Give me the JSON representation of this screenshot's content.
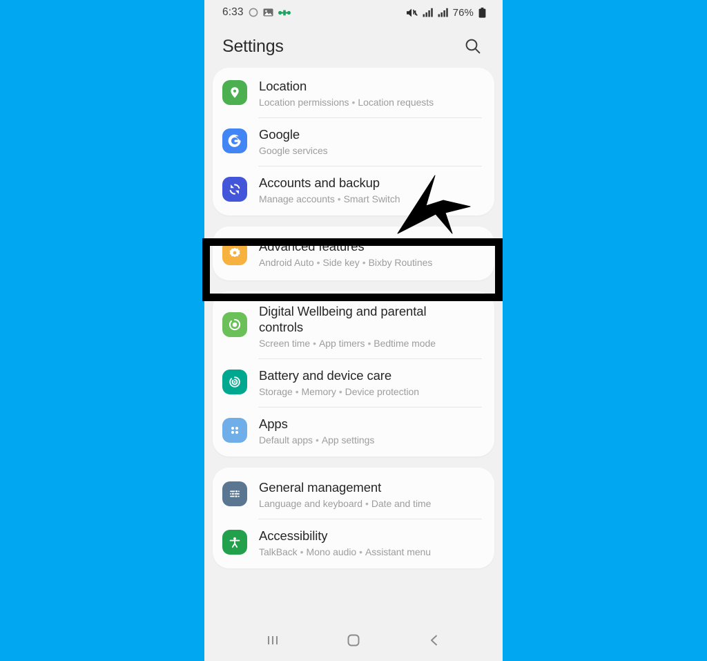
{
  "background_color": "#02A7F2",
  "status_bar": {
    "time": "6:33",
    "battery_percent": "76%",
    "left_icons": [
      "circle-icon",
      "photo-icon",
      "bluetooth-connected-icon"
    ],
    "right_icons": [
      "mute-icon",
      "signal-bars-icon",
      "signal-bars-icon",
      "battery-icon"
    ]
  },
  "header": {
    "title": "Settings",
    "search_icon": "search-icon"
  },
  "groups": [
    {
      "id": "group-accounts",
      "items": [
        {
          "title": "Location",
          "subtitle_parts": [
            "Location permissions",
            "Location requests"
          ],
          "icon": "location-pin-icon",
          "icon_color": "#4CAF50"
        },
        {
          "title": "Google",
          "subtitle_parts": [
            "Google services"
          ],
          "icon": "google-g-icon",
          "icon_color": "#4285F4"
        },
        {
          "title": "Accounts and backup",
          "subtitle_parts": [
            "Manage accounts",
            "Smart Switch"
          ],
          "icon": "sync-accounts-icon",
          "icon_color": "#4355D8"
        }
      ]
    },
    {
      "id": "group-advanced",
      "highlighted": true,
      "items": [
        {
          "title": "Advanced features",
          "subtitle_parts": [
            "Android Auto",
            "Side key",
            "Bixby Routines"
          ],
          "icon": "advanced-gear-icon",
          "icon_color": "#F7B13E"
        }
      ]
    },
    {
      "id": "group-device",
      "items": [
        {
          "title": "Digital Wellbeing and parental controls",
          "subtitle_parts": [
            "Screen time",
            "App timers",
            "Bedtime mode"
          ],
          "icon": "wellbeing-icon",
          "icon_color": "#6CC05A"
        },
        {
          "title": "Battery and device care",
          "subtitle_parts": [
            "Storage",
            "Memory",
            "Device protection"
          ],
          "icon": "device-care-icon",
          "icon_color": "#00A88F"
        },
        {
          "title": "Apps",
          "subtitle_parts": [
            "Default apps",
            "App settings"
          ],
          "icon": "apps-grid-icon",
          "icon_color": "#6FAEE8"
        }
      ]
    },
    {
      "id": "group-system",
      "items": [
        {
          "title": "General management",
          "subtitle_parts": [
            "Language and keyboard",
            "Date and time"
          ],
          "icon": "sliders-icon",
          "icon_color": "#5B7690"
        },
        {
          "title": "Accessibility",
          "subtitle_parts": [
            "TalkBack",
            "Mono audio",
            "Assistant menu"
          ],
          "icon": "accessibility-person-icon",
          "icon_color": "#22A04C"
        }
      ]
    }
  ],
  "annotation": {
    "highlight_target": "Advanced features",
    "highlight_color": "#000000",
    "pointer": "arrow-cursor"
  },
  "nav_bar": {
    "recents_icon": "recent-apps-icon",
    "home_icon": "home-icon",
    "back_icon": "back-chevron-icon"
  }
}
